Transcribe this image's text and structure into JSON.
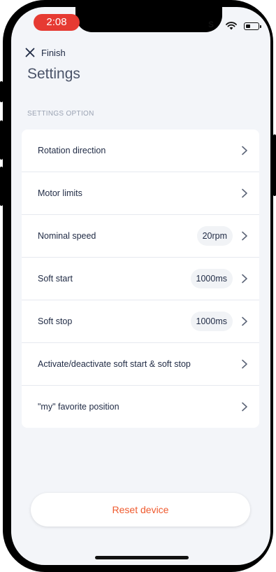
{
  "status_bar": {
    "time": "2:08",
    "carrier": "░S",
    "icons": [
      "wifi-icon",
      "battery-icon"
    ]
  },
  "header": {
    "finish_label": "Finish",
    "finish_icon": "close-icon",
    "title": "Settings"
  },
  "section": {
    "label": "SETTINGS OPTION"
  },
  "settings": {
    "items": [
      {
        "label": "Rotation direction",
        "value": ""
      },
      {
        "label": "Motor limits",
        "value": ""
      },
      {
        "label": "Nominal speed",
        "value": "20rpm"
      },
      {
        "label": "Soft start",
        "value": "1000ms"
      },
      {
        "label": "Soft stop",
        "value": "1000ms"
      },
      {
        "label": "Activate/deactivate soft start & soft stop",
        "value": ""
      },
      {
        "label": "\"my\" favorite position",
        "value": ""
      }
    ]
  },
  "footer": {
    "reset_label": "Reset device"
  },
  "colors": {
    "accent": "#ef5a2e",
    "time_pill": "#e63a32",
    "background": "#f3f5f9",
    "text_primary": "#1f2a44"
  }
}
